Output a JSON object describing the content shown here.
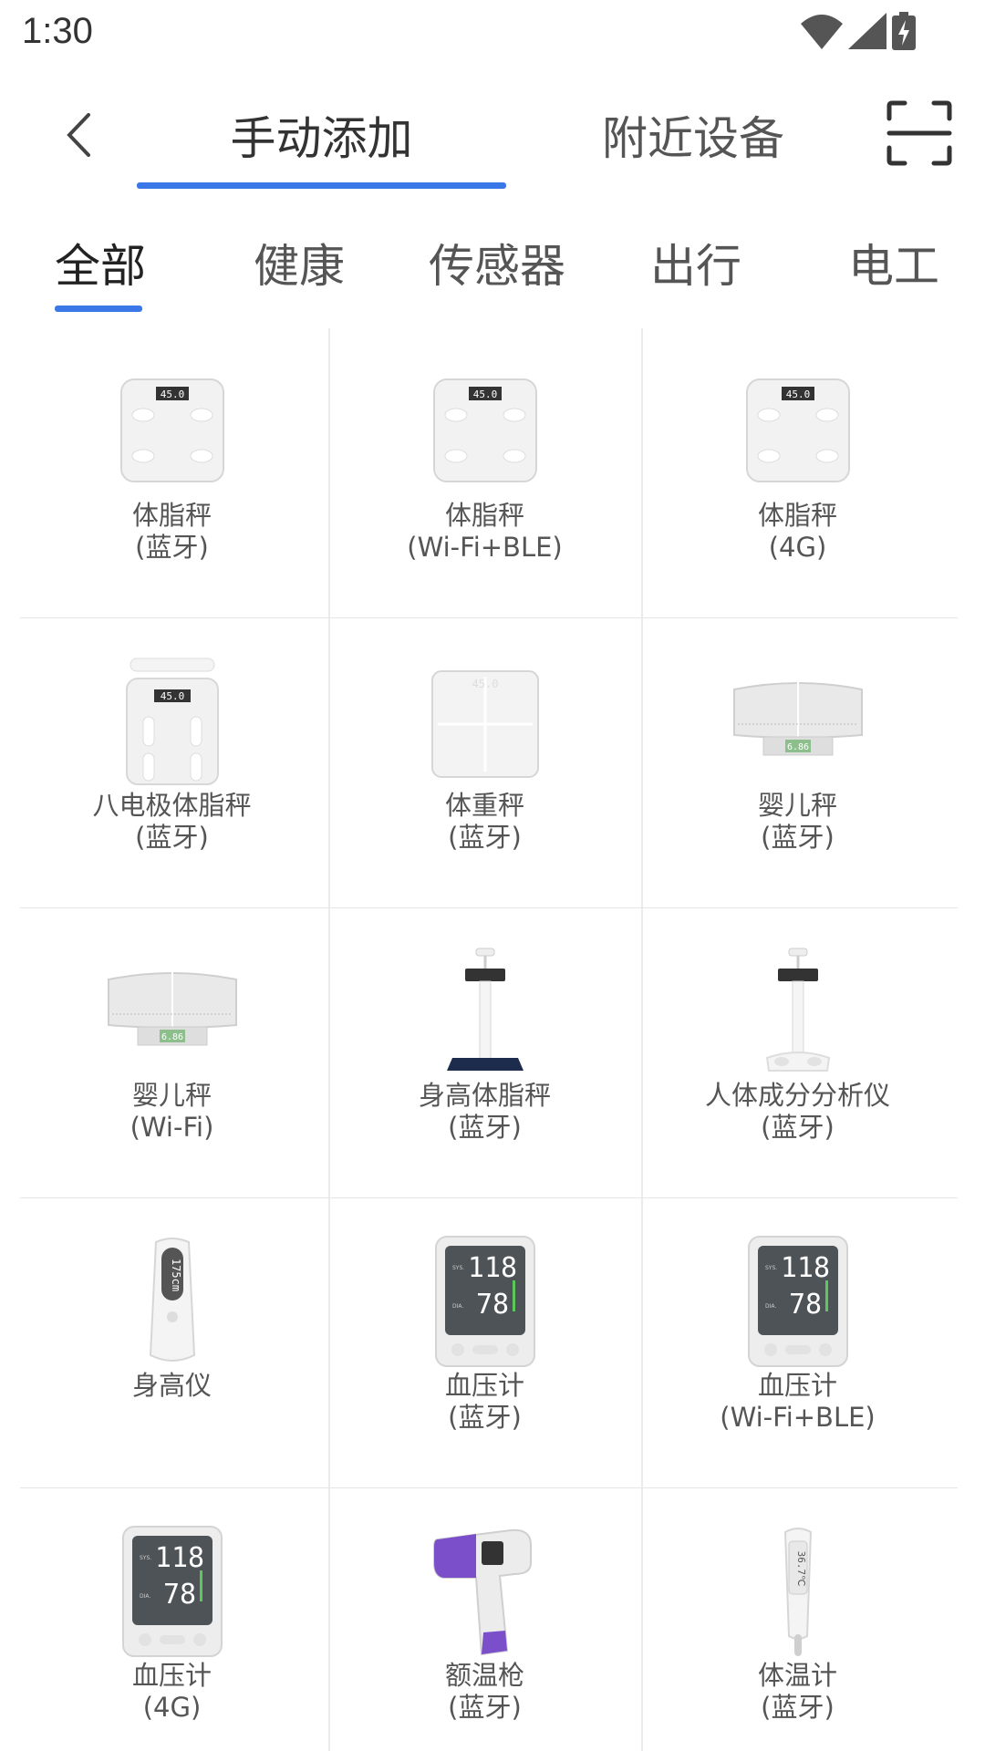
{
  "status_bar": {
    "time": "1:30"
  },
  "header": {
    "tabs": [
      {
        "label": "手动添加",
        "active": true
      },
      {
        "label": "附近设备",
        "active": false
      }
    ]
  },
  "categories": [
    {
      "label": "全部",
      "active": true
    },
    {
      "label": "健康"
    },
    {
      "label": "传感器"
    },
    {
      "label": "出行"
    },
    {
      "label": "电工"
    }
  ],
  "devices": [
    {
      "name": "体脂秤",
      "sub": "(蓝牙)",
      "icon": "scale-icon",
      "display": "45.0"
    },
    {
      "name": "体脂秤",
      "sub": "(Wi-Fi+BLE)",
      "icon": "scale-icon",
      "display": "45.0"
    },
    {
      "name": "体脂秤",
      "sub": "(4G)",
      "icon": "scale-icon",
      "display": "45.0"
    },
    {
      "name": "八电极体脂秤",
      "sub": "(蓝牙)",
      "icon": "eight-electrode-scale-icon",
      "display": "45.0"
    },
    {
      "name": "体重秤",
      "sub": "(蓝牙)",
      "icon": "weight-scale-icon",
      "display": "45.0"
    },
    {
      "name": "婴儿秤",
      "sub": "(蓝牙)",
      "icon": "baby-scale-icon",
      "display": "6.86"
    },
    {
      "name": "婴儿秤",
      "sub": "(Wi-Fi)",
      "icon": "baby-scale-icon",
      "display": "6.86"
    },
    {
      "name": "身高体脂秤",
      "sub": "(蓝牙)",
      "icon": "height-scale-icon",
      "display": ""
    },
    {
      "name": "人体成分分析仪",
      "sub": "(蓝牙)",
      "icon": "body-composition-analyzer-icon",
      "display": ""
    },
    {
      "name": "身高仪",
      "sub": "",
      "icon": "height-meter-icon",
      "display": "175cm"
    },
    {
      "name": "血压计",
      "sub": "(蓝牙)",
      "icon": "blood-pressure-monitor-icon",
      "display": "118 78"
    },
    {
      "name": "血压计",
      "sub": "(Wi-Fi+BLE)",
      "icon": "blood-pressure-monitor-icon",
      "display": "118 78"
    },
    {
      "name": "血压计",
      "sub": "(4G)",
      "icon": "blood-pressure-monitor-icon",
      "display": "118 78"
    },
    {
      "name": "额温枪",
      "sub": "(蓝牙)",
      "icon": "forehead-thermometer-icon",
      "display": ""
    },
    {
      "name": "体温计",
      "sub": "(蓝牙)",
      "icon": "thermometer-icon",
      "display": "36.7℃"
    }
  ]
}
